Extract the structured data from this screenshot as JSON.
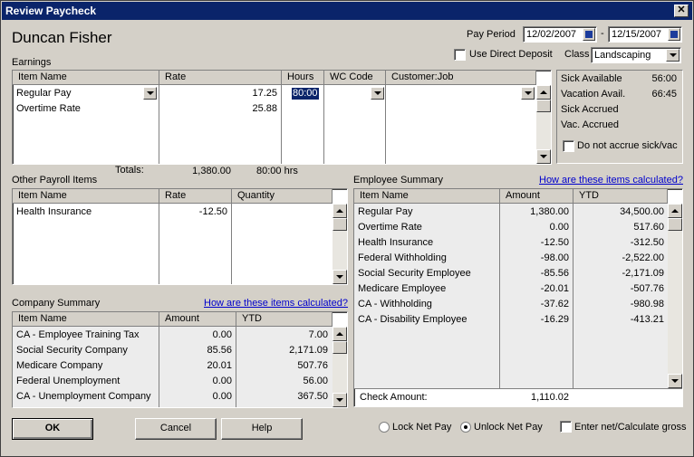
{
  "window": {
    "title": "Review Paycheck",
    "close": "✕"
  },
  "employee": {
    "name": "Duncan Fisher"
  },
  "pay_period": {
    "label": "Pay Period",
    "start": "12/02/2007",
    "separator": "-",
    "end": "12/15/2007"
  },
  "direct_deposit": {
    "label": "Use Direct Deposit",
    "checked": false
  },
  "class": {
    "label": "Class",
    "value": "Landscaping"
  },
  "earnings": {
    "label": "Earnings",
    "columns": [
      "Item Name",
      "Rate",
      "Hours",
      "WC Code",
      "Customer:Job"
    ],
    "rows": [
      {
        "item": "Regular Pay",
        "rate": "17.25",
        "hours": "80:00"
      },
      {
        "item": "Overtime Rate",
        "rate": "25.88",
        "hours": ""
      }
    ],
    "totals_label": "Totals:",
    "totals_amount": "1,380.00",
    "totals_hours": "80:00 hrs"
  },
  "sick_vacation": {
    "rows": [
      {
        "label": "Sick Available",
        "value": "56:00"
      },
      {
        "label": "Vacation Avail.",
        "value": "66:45"
      },
      {
        "label": "Sick Accrued",
        "value": ""
      },
      {
        "label": "Vac. Accrued",
        "value": ""
      }
    ],
    "do_not_accrue": "Do not accrue sick/vac"
  },
  "other_payroll": {
    "label": "Other Payroll Items",
    "columns": [
      "Item Name",
      "Rate",
      "Quantity"
    ],
    "rows": [
      {
        "item": "Health Insurance",
        "rate": "-12.50",
        "quantity": ""
      }
    ]
  },
  "employee_summary": {
    "label": "Employee Summary",
    "link": "How are these items calculated?",
    "columns": [
      "Item Name",
      "Amount",
      "YTD"
    ],
    "rows": [
      {
        "item": "Regular Pay",
        "amount": "1,380.00",
        "ytd": "34,500.00"
      },
      {
        "item": "Overtime Rate",
        "amount": "0.00",
        "ytd": "517.60"
      },
      {
        "item": "Health Insurance",
        "amount": "-12.50",
        "ytd": "-312.50"
      },
      {
        "item": "Federal Withholding",
        "amount": "-98.00",
        "ytd": "-2,522.00"
      },
      {
        "item": "Social Security Employee",
        "amount": "-85.56",
        "ytd": "-2,171.09"
      },
      {
        "item": "Medicare Employee",
        "amount": "-20.01",
        "ytd": "-507.76"
      },
      {
        "item": "CA - Withholding",
        "amount": "-37.62",
        "ytd": "-980.98"
      },
      {
        "item": "CA - Disability Employee",
        "amount": "-16.29",
        "ytd": "-413.21"
      }
    ],
    "check_amount_label": "Check Amount:",
    "check_amount": "1,110.02"
  },
  "company_summary": {
    "label": "Company Summary",
    "link": "How are these items calculated?",
    "columns": [
      "Item Name",
      "Amount",
      "YTD"
    ],
    "rows": [
      {
        "item": "CA - Employee Training Tax",
        "amount": "0.00",
        "ytd": "7.00"
      },
      {
        "item": "Social Security Company",
        "amount": "85.56",
        "ytd": "2,171.09"
      },
      {
        "item": "Medicare Company",
        "amount": "20.01",
        "ytd": "507.76"
      },
      {
        "item": "Federal Unemployment",
        "amount": "0.00",
        "ytd": "56.00"
      },
      {
        "item": "CA - Unemployment Company",
        "amount": "0.00",
        "ytd": "367.50"
      }
    ]
  },
  "buttons": {
    "ok": "OK",
    "cancel": "Cancel",
    "help": "Help"
  },
  "options": {
    "lock": "Lock Net Pay",
    "unlock": "Unlock Net Pay",
    "selected": "unlock",
    "enter_net": "Enter net/Calculate gross"
  }
}
